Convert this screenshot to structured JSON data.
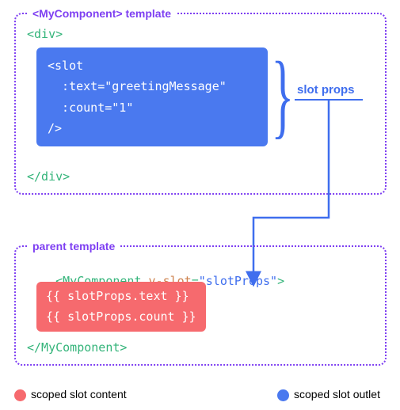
{
  "box1": {
    "title": "<MyComponent> template",
    "open_div": "<div>",
    "close_div": "</div>",
    "slot_code": "<slot\n  :text=\"greetingMessage\"\n  :count=\"1\"\n/>",
    "label": "slot props"
  },
  "box2": {
    "title": "parent template",
    "open_tag_name": "<MyComponent ",
    "open_tag_attr": "v-slot",
    "open_tag_eq": "=",
    "open_tag_val": "\"slotProps\"",
    "open_tag_close": ">",
    "close_tag": "</MyComponent>",
    "content_code": "{{ slotProps.text }}\n{{ slotProps.count }}"
  },
  "legend": {
    "left": "scoped slot content",
    "right": "scoped slot outlet"
  },
  "colors": {
    "purple": "#7e3ff2",
    "green": "#34b47a",
    "blue": "#3f6eee",
    "orange": "#ce824e",
    "slot_bg": "#4a79ef",
    "content_bg": "#f66a6e"
  }
}
